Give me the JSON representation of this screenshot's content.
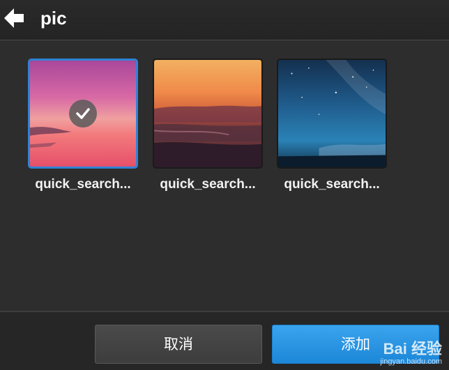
{
  "header": {
    "back_icon": "arrow-left-icon",
    "title": "pic"
  },
  "grid": {
    "items": [
      {
        "caption": "quick_search...",
        "selected": true
      },
      {
        "caption": "quick_search...",
        "selected": false
      },
      {
        "caption": "quick_search...",
        "selected": false
      }
    ]
  },
  "footer": {
    "cancel_label": "取消",
    "add_label": "添加"
  },
  "watermark": {
    "logo": "Bai 经验",
    "url": "jingyan.baidu.com"
  },
  "colors": {
    "accent": "#2f83d6",
    "add_button": "#2b97e4",
    "background": "#2d2d2d"
  }
}
